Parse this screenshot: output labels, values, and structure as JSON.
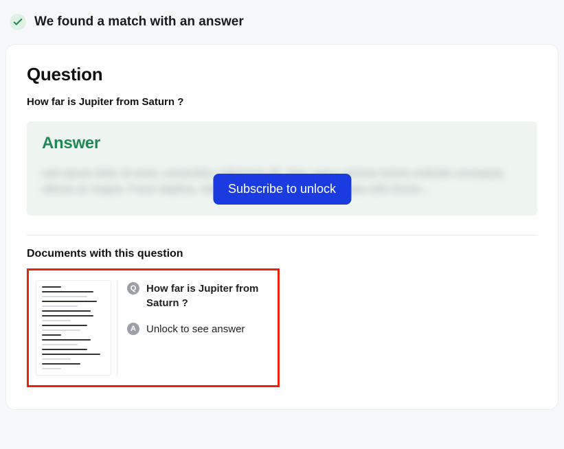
{
  "banner": {
    "text": "We found a match with an answer"
  },
  "question": {
    "heading": "Question",
    "text": "How far is Jupiter from Saturn ?"
  },
  "answer": {
    "heading": "Answer",
    "blurred_placeholder": "nam ipsum dolor sit amet, consectetur adipiscing elit. Nam sagus pulvinar tortore molestie consequat, ultrices ac magna. Fusce dapibus, tellus ac cursus sed ac, dictum vitae odio Donec...",
    "subscribe_label": "Subscribe to unlock"
  },
  "documents": {
    "heading": "Documents with this question",
    "item": {
      "q_letter": "Q",
      "q_text": "How far is Jupiter from Saturn ?",
      "a_letter": "A",
      "a_text": "Unlock to see answer"
    }
  }
}
